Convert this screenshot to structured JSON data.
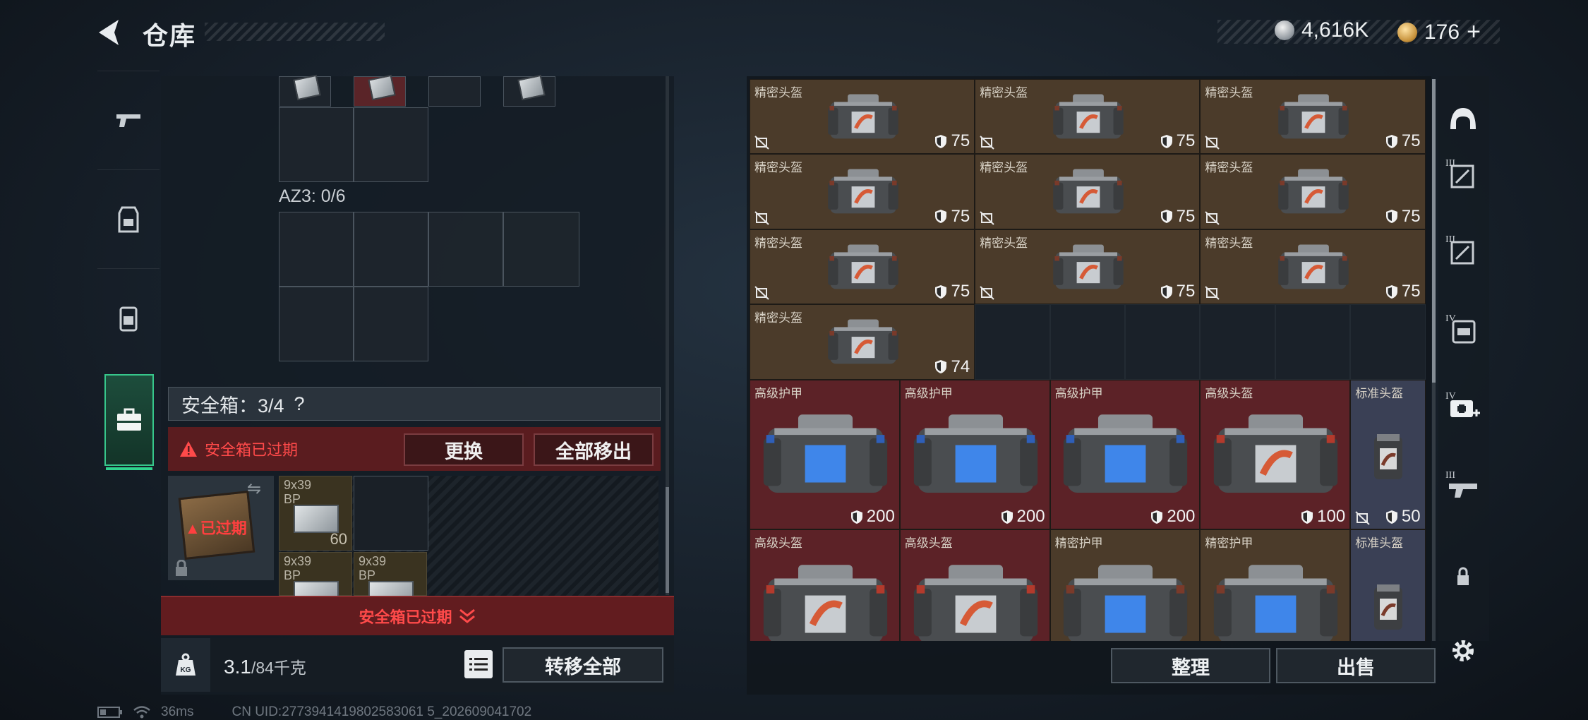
{
  "header": {
    "title": "仓库",
    "currency_silver": "4,616K",
    "currency_gold": "176",
    "currency_add": "+"
  },
  "left_tabs": [
    {
      "name": "weapon"
    },
    {
      "name": "armor-rig"
    },
    {
      "name": "backpack"
    },
    {
      "name": "secure-case",
      "active": true
    }
  ],
  "storage": {
    "az3_label": "AZ3: 0/6",
    "safe_title": "安全箱：3/4",
    "safe_help": "?",
    "expired_warning": "安全箱已过期",
    "replace_label": "更换",
    "move_all_out_label": "全部移出",
    "expired_tag": "已过期",
    "swap_symbol": "⇋",
    "ammo": [
      {
        "label": "9x39\nBP",
        "count": "60"
      },
      {
        "label": "9x39\nBP",
        "count": ""
      },
      {
        "label": "9x39\nBP",
        "count": ""
      }
    ],
    "expired_footer": "安全箱已过期",
    "weight_value": "3.1",
    "weight_max": "/84千克",
    "weight_icon_text": "KG",
    "transfer_all_label": "转移全部"
  },
  "inventory": {
    "items": [
      {
        "name": "精密头盔",
        "value": "75",
        "type": "precise",
        "kind": "helmet",
        "nodur": true
      },
      {
        "name": "精密头盔",
        "value": "75",
        "type": "precise",
        "kind": "helmet",
        "nodur": true
      },
      {
        "name": "精密头盔",
        "value": "75",
        "type": "precise",
        "kind": "helmet",
        "nodur": true
      },
      {
        "name": "精密头盔",
        "value": "75",
        "type": "precise",
        "kind": "helmet",
        "nodur": true
      },
      {
        "name": "精密头盔",
        "value": "75",
        "type": "precise",
        "kind": "helmet",
        "nodur": true
      },
      {
        "name": "精密头盔",
        "value": "75",
        "type": "precise",
        "kind": "helmet",
        "nodur": true
      },
      {
        "name": "精密头盔",
        "value": "75",
        "type": "precise",
        "kind": "helmet",
        "nodur": true
      },
      {
        "name": "精密头盔",
        "value": "75",
        "type": "precise",
        "kind": "helmet",
        "nodur": true
      },
      {
        "name": "精密头盔",
        "value": "75",
        "type": "precise",
        "kind": "helmet",
        "nodur": true
      },
      {
        "name": "精密头盔",
        "value": "74",
        "type": "precise",
        "kind": "helmet",
        "nodur": false
      },
      {
        "name": "高级护甲",
        "value": "200",
        "type": "adv",
        "kind": "armor",
        "nodur": false
      },
      {
        "name": "高级护甲",
        "value": "200",
        "type": "adv",
        "kind": "armor",
        "nodur": false
      },
      {
        "name": "高级护甲",
        "value": "200",
        "type": "adv",
        "kind": "armor",
        "nodur": false
      },
      {
        "name": "高级头盔",
        "value": "100",
        "type": "adv",
        "kind": "helmet",
        "nodur": false
      },
      {
        "name": "标准头盔",
        "value": "50",
        "type": "std",
        "kind": "small",
        "nodur": true
      },
      {
        "name": "高级头盔",
        "value": "",
        "type": "adv",
        "kind": "helmet",
        "nodur": false
      },
      {
        "name": "高级头盔",
        "value": "",
        "type": "adv",
        "kind": "helmet",
        "nodur": false
      },
      {
        "name": "精密护甲",
        "value": "",
        "type": "precise",
        "kind": "armor",
        "nodur": false
      },
      {
        "name": "精密护甲",
        "value": "",
        "type": "precise",
        "kind": "armor",
        "nodur": false
      },
      {
        "name": "标准头盔",
        "value": "",
        "type": "std",
        "kind": "small",
        "nodur": false
      }
    ],
    "sort_label": "整理",
    "sell_label": "出售"
  },
  "right_tabs": [
    {
      "name": "helmet",
      "tier": ""
    },
    {
      "name": "armor",
      "tier": "III"
    },
    {
      "name": "armor",
      "tier": "III"
    },
    {
      "name": "backpack",
      "tier": "IV"
    },
    {
      "name": "medkit-add",
      "tier": "IV"
    },
    {
      "name": "weapon",
      "tier": "III"
    },
    {
      "name": "lock",
      "tier": ""
    },
    {
      "name": "settings",
      "tier": ""
    }
  ],
  "status": {
    "ping": "36ms",
    "uid": "CN UID:2773941419802583061 5_202609041702"
  },
  "colors": {
    "accent_green": "#2fd38d",
    "warning_red": "#ff4a4a",
    "precise_bg": "#4b3b2a",
    "advanced_bg": "#5c2227",
    "standard_bg": "#3a4055"
  }
}
